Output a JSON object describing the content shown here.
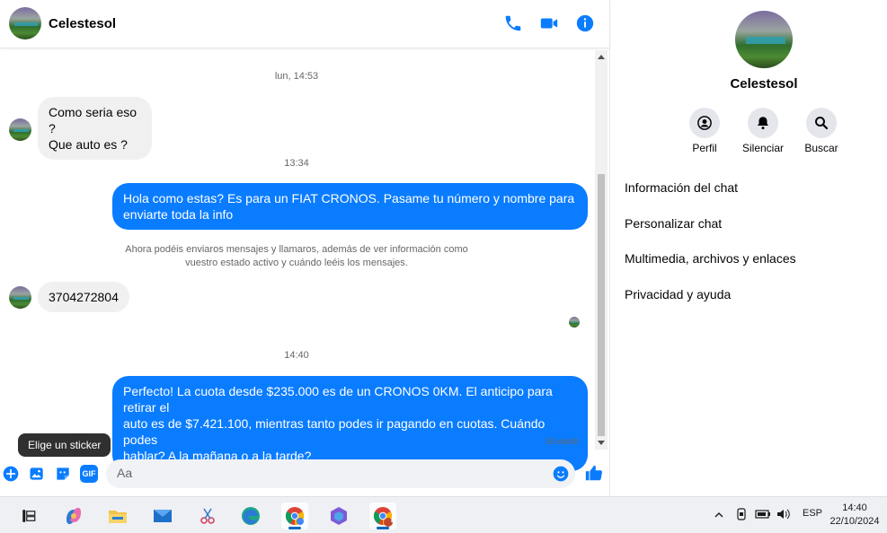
{
  "chat": {
    "contact_name": "Celestesol",
    "header_icons": [
      "phone-icon",
      "video-icon",
      "info-icon"
    ],
    "messages": {
      "ts1": "lun, 14:53",
      "in1_line1": "Como seria eso ?",
      "in1_line2": "Que auto es ?",
      "ts2": "13:34",
      "out1_line1": "Hola como estas?  Es para un FIAT CRONOS. Pasame tu número  y nombre para",
      "out1_line2": "enviarte toda la info",
      "notice_line1": "Ahora podéis enviaros mensajes y llamaros, además de ver información como",
      "notice_line2": "vuestro estado activo y cuándo leéis los mensajes.",
      "in2": "3704272804",
      "ts3": "14:40",
      "out2_line1": "Perfecto! La cuota desde $235.000 es de un CRONOS 0KM. El anticipo para retirar el",
      "out2_line2": "auto es de $7.421.100, mientras tanto podes ir pagando en cuotas. Cuándo podes",
      "out2_line3": "hablar? A la mañana o a la tarde?",
      "status": "Enviado"
    },
    "tooltip": "Elige un sticker",
    "composer": {
      "placeholder": "Aa",
      "gif_label": "GIF"
    },
    "colors": {
      "accent": "#0a7cff",
      "incoming_bg": "#f0f0f0"
    }
  },
  "info_panel": {
    "name": "Celestesol",
    "actions": [
      {
        "label": "Perfil",
        "icon": "profile-icon"
      },
      {
        "label": "Silenciar",
        "icon": "bell-icon"
      },
      {
        "label": "Buscar",
        "icon": "search-icon"
      }
    ],
    "menu": [
      "Información del chat",
      "Personalizar chat",
      "Multimedia, archivos y enlaces",
      "Privacidad y ayuda"
    ]
  },
  "taskbar": {
    "apps": [
      "task-view-icon",
      "copilot-icon",
      "file-explorer-icon",
      "mail-icon",
      "snipping-icon",
      "edge-icon",
      "chrome-profile-icon",
      "m365-icon",
      "chrome-icon"
    ],
    "chrome_badge": "B",
    "language": "ESP",
    "time": "14:40",
    "date": "22/10/2024"
  }
}
